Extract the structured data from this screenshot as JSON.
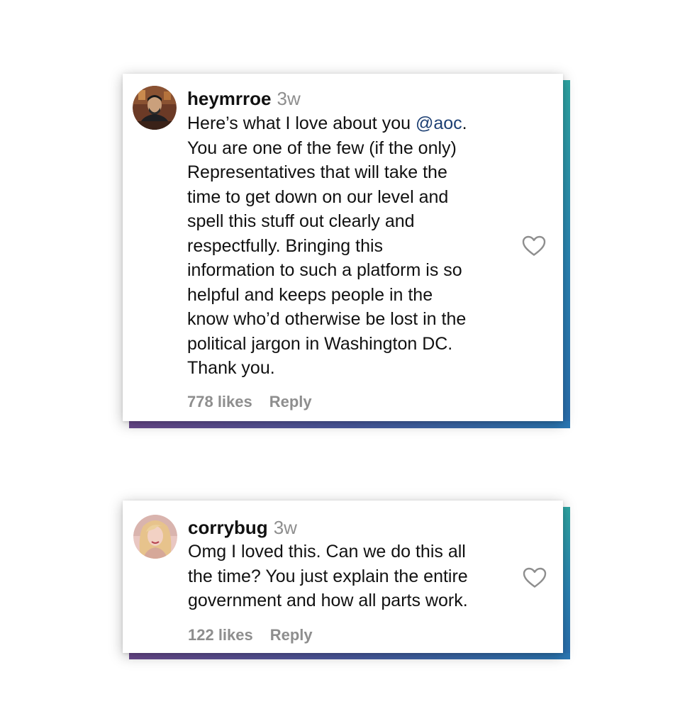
{
  "comments": [
    {
      "username": "heymrroe",
      "time": "3w",
      "text_lines": [
        "Here’s what I love about you ",
        "You are one of the few (if the only)",
        "Representatives that will take the",
        "time to get down on our level and",
        "spell this stuff out clearly and",
        "respectfully. Bringing this",
        "information to such a platform is so",
        "helpful and keeps people in the",
        "know who’d otherwise be lost in the",
        "political jargon in Washington DC.",
        "Thank you."
      ],
      "mention": "@aoc",
      "mention_suffix": ".",
      "likes": "778 likes",
      "reply_label": "Reply"
    },
    {
      "username": "corrybug",
      "time": "3w",
      "text_lines": [
        "Omg I loved this. Can we do this all",
        "the time? You just explain the entire",
        "government and how all parts work."
      ],
      "likes": "122 likes",
      "reply_label": "Reply"
    }
  ],
  "colors": {
    "mention": "#1c3f73",
    "muted": "#8e8e8e",
    "accent_top": "#2fa7a5",
    "accent_bottom": "#6a4a8e"
  },
  "icons": {
    "like": "heart-outline-icon"
  }
}
